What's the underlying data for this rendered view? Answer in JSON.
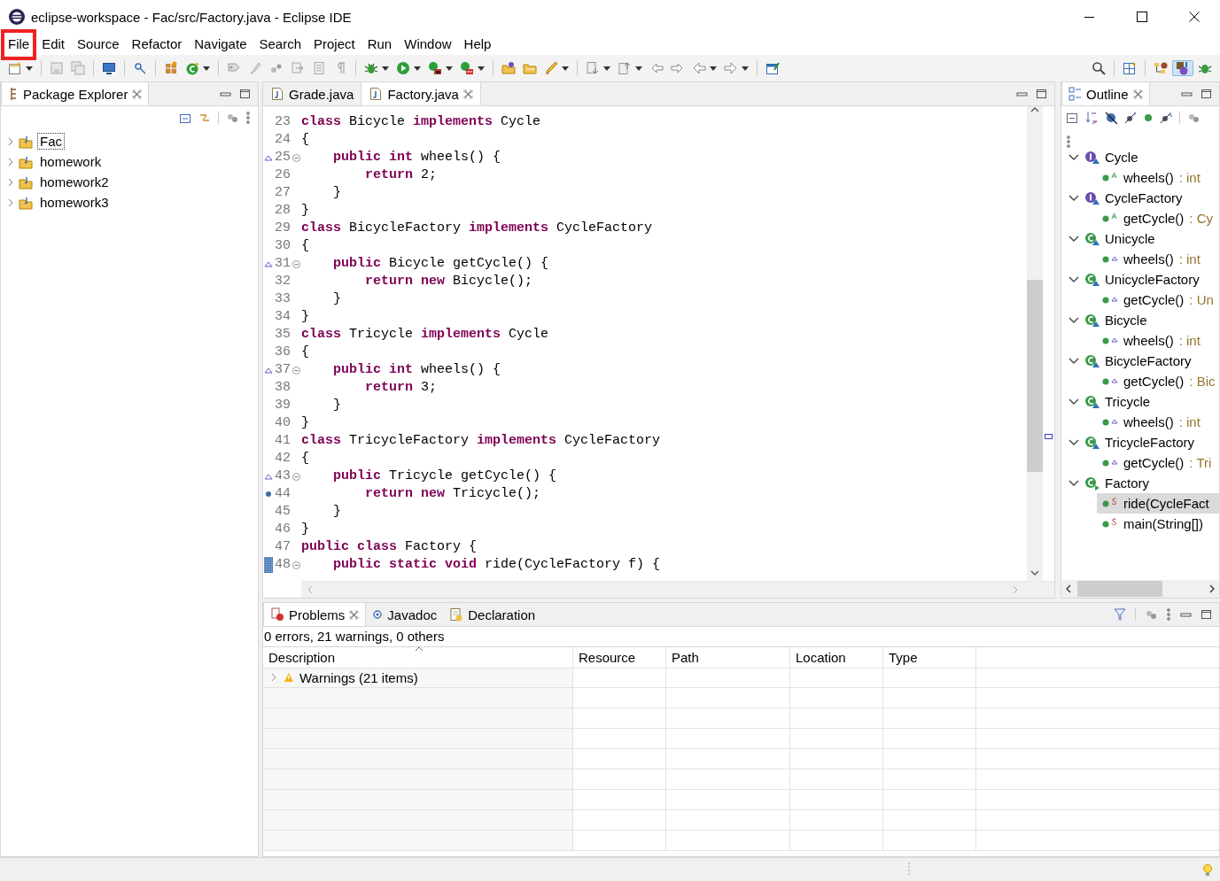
{
  "window": {
    "title": "eclipse-workspace - Fac/src/Factory.java - Eclipse IDE"
  },
  "menu": [
    {
      "label": "File",
      "highlighted": true
    },
    {
      "label": "Edit",
      "highlighted": false
    },
    {
      "label": "Source",
      "highlighted": false
    },
    {
      "label": "Refactor",
      "highlighted": false
    },
    {
      "label": "Navigate",
      "highlighted": false
    },
    {
      "label": "Search",
      "highlighted": false
    },
    {
      "label": "Project",
      "highlighted": false
    },
    {
      "label": "Run",
      "highlighted": false
    },
    {
      "label": "Window",
      "highlighted": false
    },
    {
      "label": "Help",
      "highlighted": false
    }
  ],
  "package_explorer": {
    "title": "Package Explorer",
    "projects": [
      {
        "name": "Fac",
        "selected": true
      },
      {
        "name": "homework",
        "selected": false
      },
      {
        "name": "homework2",
        "selected": false
      },
      {
        "name": "homework3",
        "selected": false
      }
    ]
  },
  "editor": {
    "tabs": [
      {
        "label": "Grade.java",
        "selected": false
      },
      {
        "label": "Factory.java",
        "selected": true
      }
    ],
    "lines": [
      {
        "number": "23",
        "text": "**class** Bicycle **implements** Cycle",
        "foldable": false,
        "override": false,
        "occurrence": false,
        "current": false
      },
      {
        "number": "24",
        "text": "{",
        "foldable": false,
        "override": false,
        "occurrence": false,
        "current": false
      },
      {
        "number": "25",
        "text": "    **public int** wheels() {",
        "foldable": true,
        "override": true,
        "occurrence": false,
        "current": false
      },
      {
        "number": "26",
        "text": "        **return** 2;",
        "foldable": false,
        "override": false,
        "occurrence": false,
        "current": false
      },
      {
        "number": "27",
        "text": "    }",
        "foldable": false,
        "override": false,
        "occurrence": false,
        "current": false
      },
      {
        "number": "28",
        "text": "}",
        "foldable": false,
        "override": false,
        "occurrence": false,
        "current": false
      },
      {
        "number": "29",
        "text": "**class** BicycleFactory **implements** CycleFactory",
        "foldable": false,
        "override": false,
        "occurrence": false,
        "current": false
      },
      {
        "number": "30",
        "text": "{",
        "foldable": false,
        "override": false,
        "occurrence": false,
        "current": false
      },
      {
        "number": "31",
        "text": "    **public** Bicycle getCycle() {",
        "foldable": true,
        "override": true,
        "occurrence": false,
        "current": false
      },
      {
        "number": "32",
        "text": "        **return new** Bicycle();",
        "foldable": false,
        "override": false,
        "occurrence": false,
        "current": false
      },
      {
        "number": "33",
        "text": "    }",
        "foldable": false,
        "override": false,
        "occurrence": false,
        "current": false
      },
      {
        "number": "34",
        "text": "}",
        "foldable": false,
        "override": false,
        "occurrence": false,
        "current": false
      },
      {
        "number": "35",
        "text": "**class** Tricycle **implements** Cycle",
        "foldable": false,
        "override": false,
        "occurrence": false,
        "current": false
      },
      {
        "number": "36",
        "text": "{",
        "foldable": false,
        "override": false,
        "occurrence": false,
        "current": false
      },
      {
        "number": "37",
        "text": "    **public int** wheels() {",
        "foldable": true,
        "override": true,
        "occurrence": false,
        "current": false
      },
      {
        "number": "38",
        "text": "        **return** 3;",
        "foldable": false,
        "override": false,
        "occurrence": false,
        "current": false
      },
      {
        "number": "39",
        "text": "    }",
        "foldable": false,
        "override": false,
        "occurrence": false,
        "current": false
      },
      {
        "number": "40",
        "text": "}",
        "foldable": false,
        "override": false,
        "occurrence": false,
        "current": false
      },
      {
        "number": "41",
        "text": "**class** TricycleFactory **implements** CycleFactory",
        "foldable": false,
        "override": false,
        "occurrence": false,
        "current": false
      },
      {
        "number": "42",
        "text": "{",
        "foldable": false,
        "override": false,
        "occurrence": false,
        "current": false
      },
      {
        "number": "43",
        "text": "    **public** Tricycle getCycle() {",
        "foldable": true,
        "override": true,
        "occurrence": false,
        "current": false
      },
      {
        "number": "44",
        "text": "        **return new** Tricycle();",
        "foldable": false,
        "override": false,
        "occurrence": true,
        "current": false
      },
      {
        "number": "45",
        "text": "    }",
        "foldable": false,
        "override": false,
        "occurrence": false,
        "current": false
      },
      {
        "number": "46",
        "text": "}",
        "foldable": false,
        "override": false,
        "occurrence": false,
        "current": false
      },
      {
        "number": "47",
        "text": "**public class** Factory {",
        "foldable": false,
        "override": false,
        "occurrence": false,
        "current": false
      },
      {
        "number": "48",
        "text": "    **public static void** ride(CycleFactory f) {",
        "foldable": true,
        "override": false,
        "occurrence": false,
        "current": true
      }
    ]
  },
  "outline": {
    "title": "Outline",
    "items": [
      {
        "name": "Cycle",
        "kind": "interface",
        "expanded": true,
        "children": [
          {
            "signature": "wheels()",
            "type": ": int",
            "kind": "abstract",
            "selected": false
          }
        ]
      },
      {
        "name": "CycleFactory",
        "kind": "interface",
        "expanded": true,
        "children": [
          {
            "signature": "getCycle()",
            "type": ": Cy",
            "kind": "abstract",
            "selected": false
          }
        ]
      },
      {
        "name": "Unicycle",
        "kind": "class",
        "expanded": true,
        "children": [
          {
            "signature": "wheels()",
            "type": ": int",
            "kind": "default",
            "selected": false
          }
        ]
      },
      {
        "name": "UnicycleFactory",
        "kind": "class",
        "expanded": true,
        "children": [
          {
            "signature": "getCycle()",
            "type": ": Un",
            "kind": "default",
            "selected": false
          }
        ]
      },
      {
        "name": "Bicycle",
        "kind": "class",
        "expanded": true,
        "children": [
          {
            "signature": "wheels()",
            "type": ": int",
            "kind": "default",
            "selected": false
          }
        ]
      },
      {
        "name": "BicycleFactory",
        "kind": "class",
        "expanded": true,
        "children": [
          {
            "signature": "getCycle()",
            "type": ": Bic",
            "kind": "default",
            "selected": false
          }
        ]
      },
      {
        "name": "Tricycle",
        "kind": "class",
        "expanded": true,
        "children": [
          {
            "signature": "wheels()",
            "type": ": int",
            "kind": "default",
            "selected": false
          }
        ]
      },
      {
        "name": "TricycleFactory",
        "kind": "class",
        "expanded": true,
        "children": [
          {
            "signature": "getCycle()",
            "type": ": Tri",
            "kind": "default",
            "selected": false
          }
        ]
      },
      {
        "name": "Factory",
        "kind": "main-class",
        "expanded": true,
        "children": [
          {
            "signature": "ride(CycleFact",
            "kind": "static",
            "selected": true
          },
          {
            "signature": "main(String[])",
            "kind": "static",
            "selected": false
          }
        ]
      }
    ]
  },
  "problems": {
    "tabs": [
      {
        "label": "Problems",
        "selected": true
      },
      {
        "label": "Javadoc",
        "selected": false
      },
      {
        "label": "Declaration",
        "selected": false
      }
    ],
    "summary": "0 errors, 21 warnings, 0 others",
    "columns": [
      "Description",
      "Resource",
      "Path",
      "Location",
      "Type"
    ],
    "rows": [
      {
        "description": "Warnings (21 items)",
        "expanded": false
      }
    ]
  }
}
